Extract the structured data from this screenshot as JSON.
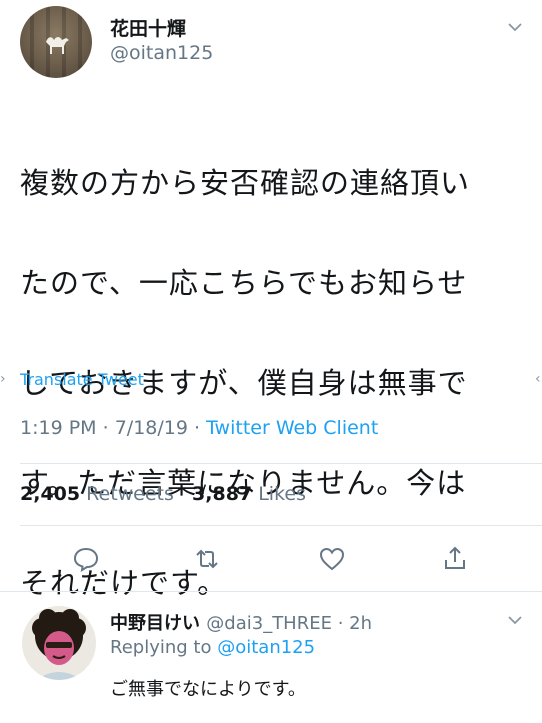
{
  "tweet": {
    "author_name": "花田十輝",
    "author_handle": "@oitan125",
    "text_lines": [
      "複数の方から安否確認の連絡頂い",
      "たので、一応こちらでもお知らせ",
      "しておきますが、僕自身は無事で",
      "す。ただ言葉になりません。今は",
      "それだけです。"
    ],
    "translate_label": "Translate Tweet",
    "time": "1:19 PM",
    "date": "7/18/19",
    "client": "Twitter Web Client",
    "retweets_count": "2,405",
    "retweets_label": "Retweets",
    "likes_count": "3,887",
    "likes_label": "Likes"
  },
  "reply": {
    "author_name": "中野目けい",
    "author_handle": "@dai3_THREE",
    "time_ago": "2h",
    "replying_prefix": "Replying to",
    "replying_to": "@oitan125",
    "text": "ご無事でなによりです。"
  },
  "icons": [
    "chevron-down-icon",
    "reply-icon",
    "retweet-icon",
    "like-icon",
    "share-icon"
  ],
  "colors": {
    "accent": "#1da1f2",
    "muted": "#657786",
    "text": "#14171a",
    "divider": "#e1e8ed"
  }
}
